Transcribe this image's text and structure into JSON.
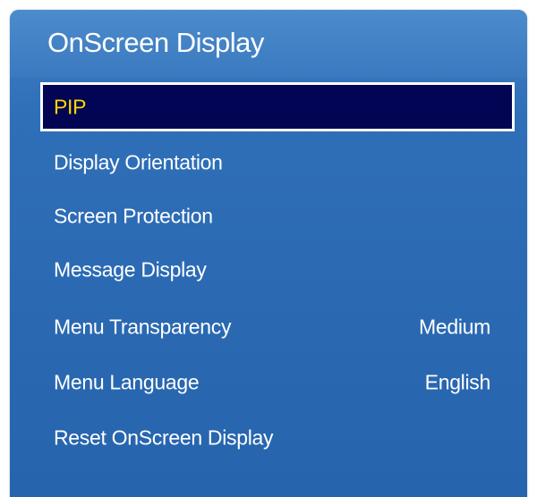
{
  "menu": {
    "title": "OnScreen Display",
    "items": [
      {
        "label": "PIP",
        "value": "",
        "selected": true
      },
      {
        "label": "Display Orientation",
        "value": ""
      },
      {
        "label": "Screen Protection",
        "value": ""
      },
      {
        "label": "Message Display",
        "value": ""
      },
      {
        "label": "Menu Transparency",
        "value": "Medium"
      },
      {
        "label": "Menu Language",
        "value": "English"
      },
      {
        "label": "Reset OnScreen Display",
        "value": ""
      }
    ]
  },
  "colors": {
    "panel_background": "#2a68b0",
    "selected_background": "#010553",
    "selected_text": "#ffd700",
    "text": "#ffffff"
  }
}
